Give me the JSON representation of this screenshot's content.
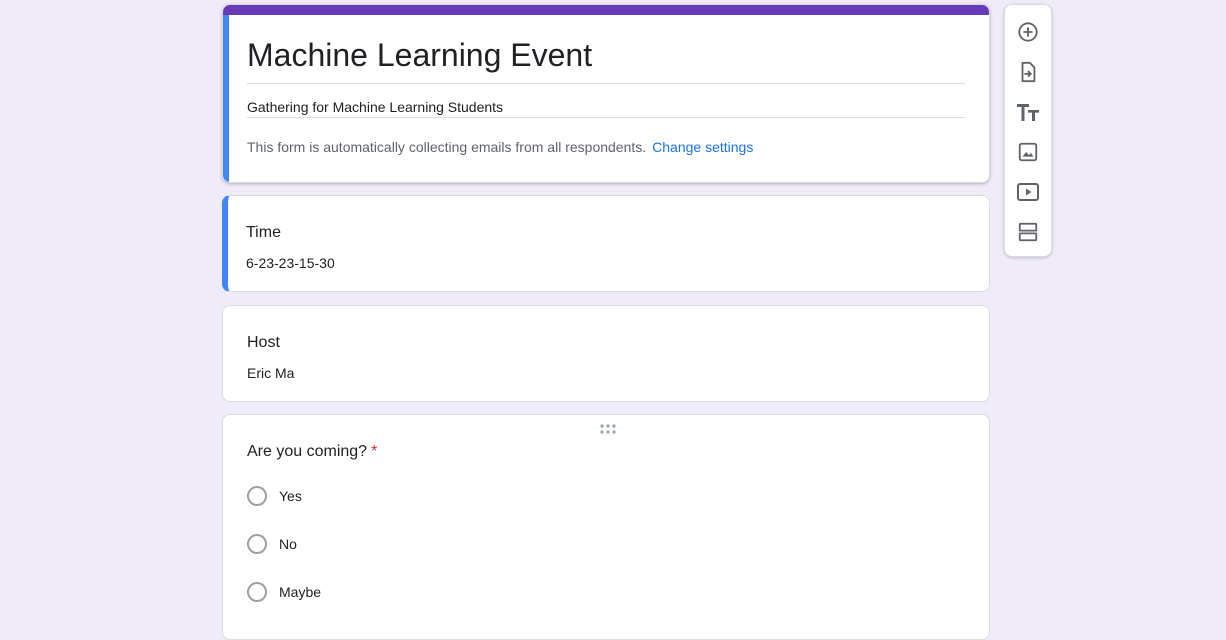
{
  "form": {
    "title": "Machine Learning Event",
    "description": "Gathering for Machine Learning Students",
    "email_note": "This form is automatically collecting emails from all respondents.",
    "change_settings_label": "Change settings"
  },
  "sections": [
    {
      "title": "Time",
      "body": "6-23-23-15-30"
    },
    {
      "title": "Host",
      "body": "Eric Ma"
    }
  ],
  "question": {
    "title": "Are you coming?",
    "required_marker": "*",
    "options": [
      "Yes",
      "No",
      "Maybe"
    ]
  },
  "toolbar": {
    "tools": [
      "add-question-icon",
      "import-questions-icon",
      "add-title-description-icon",
      "add-image-icon",
      "add-video-icon",
      "add-section-icon"
    ]
  },
  "colors": {
    "background": "#f0ebf8",
    "header_band": "#673ab7",
    "active_accent": "#4285f4",
    "link": "#1a73e8",
    "required": "#d93025"
  }
}
